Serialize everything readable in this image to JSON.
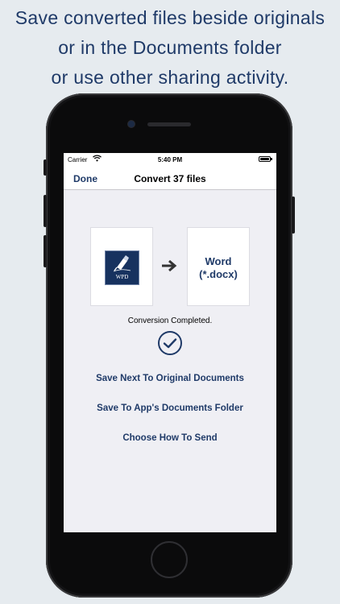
{
  "caption": {
    "line1": "Save converted files beside originals",
    "line2": "or in the Documents folder",
    "line3": "or use other sharing activity."
  },
  "status_bar": {
    "carrier": "Carrier",
    "time": "5:40 PM"
  },
  "nav": {
    "done_label": "Done",
    "title": "Convert 37 files"
  },
  "conversion": {
    "source_logo_text": "WPD",
    "target_line1": "Word",
    "target_line2": "(*.docx)",
    "status": "Conversion Completed."
  },
  "actions": {
    "save_next_to_original": "Save Next To Original Documents",
    "save_to_documents": "Save To App's Documents Folder",
    "choose_how_to_send": "Choose How To Send"
  },
  "colors": {
    "accent": "#1f3a68",
    "background": "#e6ebef",
    "screen_background": "#efeff4",
    "logo_background": "#17325f"
  },
  "icons": {
    "arrow": "arrow-right-icon",
    "checkmark": "checkmark-circle-icon",
    "wifi": "wifi-icon",
    "battery": "battery-icon",
    "pen": "fountain-pen-icon"
  }
}
